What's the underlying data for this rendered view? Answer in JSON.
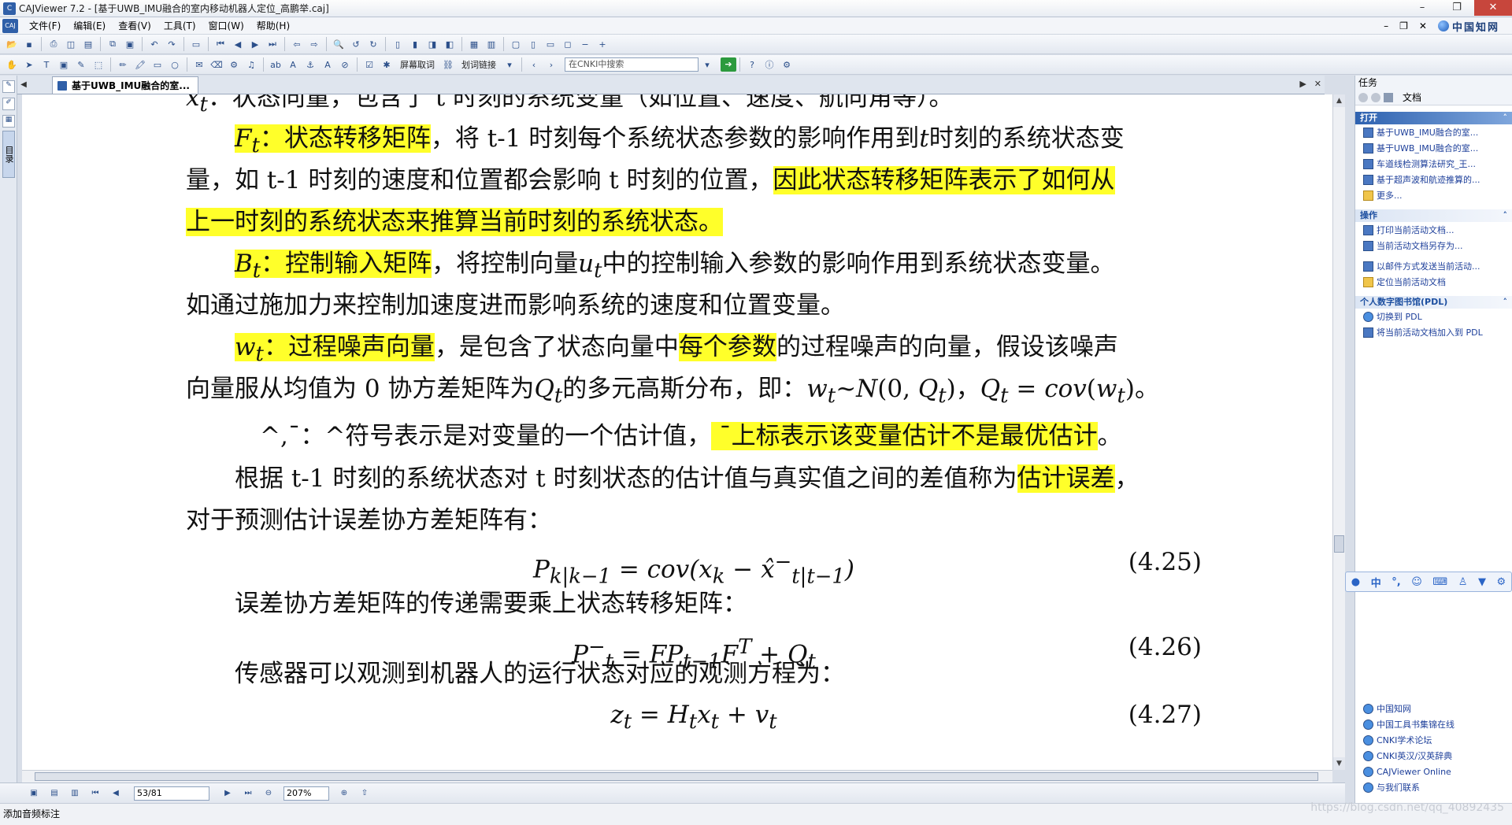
{
  "window": {
    "title": "CAJViewer 7.2 - [基于UWB_IMU融合的室内移动机器人定位_高鹏举.caj]",
    "app_icon": "cajviewer-app-icon"
  },
  "menubar": {
    "items": [
      "文件(F)",
      "编辑(E)",
      "查看(V)",
      "工具(T)",
      "窗口(W)",
      "帮助(H)"
    ],
    "brand": "中国知网"
  },
  "toolbar": {
    "screen_text": "屏幕取词",
    "link_text": "划词链接",
    "search_placeholder": "在CNKI中搜索"
  },
  "tabs": {
    "doc_tab": "基于UWB_IMU融合的室..."
  },
  "left_strip": {
    "toc_label": "目录"
  },
  "document": {
    "line0_cut": "：状态向量，包含了 t 时刻的系统变量（如位置、速度、航向角等）。",
    "p1_term": "状态转移矩阵",
    "p1_a": "，将 t-1 时刻每个系统状态参数的影响作用到",
    "p1_b": "时刻的系统状态变",
    "p1_c": "量，如 t-1 时刻的速度和位置都会影响 t 时刻的位置，",
    "p1_hl1": "因此状态转移矩阵表示了如何从",
    "p1_hl2": "上一时刻的系统状态来推算当前时刻的系统状态。",
    "p2_term": "控制输入矩阵",
    "p2_a": "，将控制向量",
    "p2_b": "中的控制输入参数的影响作用到系统状态变量。",
    "p2_c": "如通过施加力来控制加速度进而影响系统的速度和位置变量。",
    "p3_term": "过程噪声向量",
    "p3_a": "，是包含了状态向量中",
    "p3_hl": "每个参数",
    "p3_b": "的过程噪声的向量，假设该噪声",
    "p3_c": "向量服从均值为 0 协方差矩阵为",
    "p3_d": "的多元高斯分布，即：",
    "p4_a": "^,¯：^符号表示是对变量的一个估计值，",
    "p4_hl": "上标表示该变量估计不是最优估计",
    "p4_b": "。",
    "p5_a": "根据 t-1 时刻的系统状态对 t 时刻状态的估计值与真实值之间的差值称为",
    "p5_hl": "估计误差",
    "p5_b": "，",
    "p5_c": "对于预测估计误差协方差矩阵有：",
    "eq25_num": "(4.25)",
    "p6": "误差协方差矩阵的传递需要乘上状态转移矩阵：",
    "eq26_num": "(4.26)",
    "p7": "传感器可以观测到机器人的运行状态对应的观测方程为：",
    "eq27_num": "(4.27)"
  },
  "statusbar": {
    "page": "53/81",
    "zoom": "207%",
    "bottom_text": "添加音频标注",
    "watermark": "https://blog.csdn.net/qq_40892435"
  },
  "taskpane": {
    "title": "任务",
    "nav_label": "文档",
    "open_header": "打开",
    "open_items": [
      "基于UWB_IMU融合的室...",
      "基于UWB_IMU融合的室...",
      "车道线检测算法研究_王...",
      "基于超声波和航迹推算的...",
      "更多..."
    ],
    "ops_header": "操作",
    "ops_items": [
      "打印当前活动文档...",
      "当前活动文档另存为...",
      "以邮件方式发送当前活动...",
      "定位当前活动文档"
    ],
    "pdl_header": "个人数字图书馆(PDL)",
    "pdl_items": [
      "切换到 PDL",
      "将当前活动文档加入到 PDL"
    ],
    "links": [
      "中国知网",
      "中国工具书集锦在线",
      "CNKI学术论坛",
      "CNKI英汉/汉英辞典",
      "CAJViewer Online",
      "与我们联系"
    ]
  }
}
